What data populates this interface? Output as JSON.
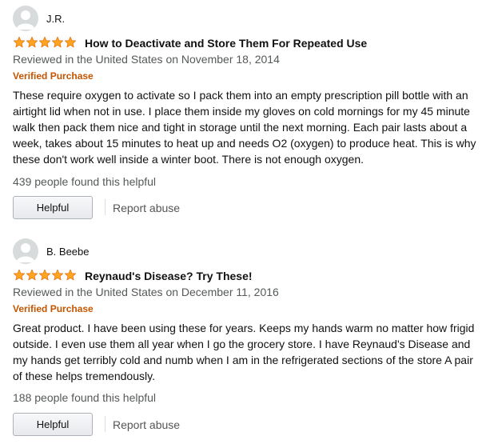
{
  "reviews": [
    {
      "author": "J.R.",
      "rating": 5,
      "rating_max": 5,
      "title": "How to Deactivate and Store Them For Repeated Use",
      "date_line": "Reviewed in the United States on November 18, 2014",
      "badge": "Verified Purchase",
      "body": "These require oxygen to activate so I pack them into an empty prescription pill bottle with an airtight lid when not in use. I place them inside my gloves on cold mornings for my 45 minute walk then pack them nice and tight in storage until the next morning. Each pair lasts about a week, takes about 15 minutes to heat up and needs O2 (oxygen) to produce heat. This is why these don't work well inside a winter boot. There is not enough oxygen.",
      "helpful_count": "439 people found this helpful",
      "helpful_label": "Helpful",
      "report_label": "Report abuse"
    },
    {
      "author": "B. Beebe",
      "rating": 5,
      "rating_max": 5,
      "title": "Reynaud's Disease? Try These!",
      "date_line": "Reviewed in the United States on December 11, 2016",
      "badge": "Verified Purchase",
      "body": "Great product. I have been using these for years. Keeps my hands warm no matter how frigid outside. I even use them all year when I go the grocery store. I have Reynaud's Disease and my hands get terribly cold and numb when I am in the refrigerated sections of the store A pair of these helps tremendously.",
      "helpful_count": "188 people found this helpful",
      "helpful_label": "Helpful",
      "report_label": "Report abuse"
    }
  ],
  "colors": {
    "star": "#ffa41c",
    "star_stroke": "#de7921",
    "verified": "#c45500",
    "meta": "#565959"
  },
  "icons": {
    "avatar": "user-silhouette-icon",
    "star": "star-icon"
  }
}
